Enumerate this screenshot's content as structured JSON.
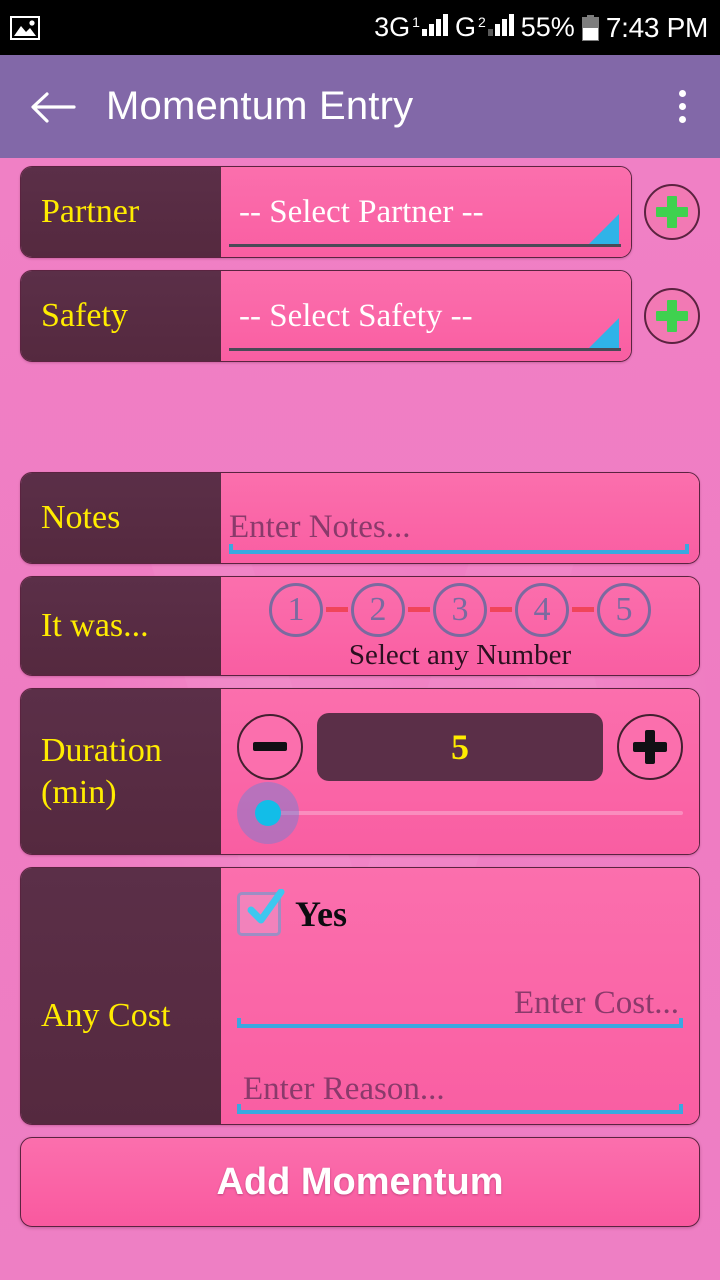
{
  "status_bar": {
    "notification_icon": "gallery-image-icon",
    "sim1_network": "3G",
    "sim1_index": "1",
    "sim2_network": "G",
    "sim2_index": "2",
    "battery_percent": "55%",
    "clock": "7:43 PM"
  },
  "app_bar": {
    "back_icon": "arrow-left-icon",
    "title": "Momentum Entry",
    "overflow_icon": "more-vertical-icon",
    "background_color": "#8268a8"
  },
  "theme": {
    "page_background": "#ef7fc4",
    "label_block": "#5b2f48",
    "label_text": "#ffec00",
    "field_background": "#fb6fad",
    "accent_blue": "#3aa8e0",
    "accent_cyan": "#2fb3e8",
    "accent_green": "#3fd14f",
    "dash_red": "#f0455a",
    "circle_purple": "#7b6aa0"
  },
  "form": {
    "partner": {
      "label": "Partner",
      "selected": "-- Select Partner --",
      "add_button": "add-partner-button"
    },
    "safety": {
      "label": "Safety",
      "selected": "-- Select Safety --",
      "add_button": "add-safety-button"
    },
    "notes": {
      "label": "Notes",
      "placeholder": "Enter Notes...",
      "value": ""
    },
    "rating": {
      "label": "It was...",
      "options": [
        "1",
        "2",
        "3",
        "4",
        "5"
      ],
      "hint": "Select any Number",
      "selected": ""
    },
    "duration": {
      "label_line1": "Duration",
      "label_line2": "(min)",
      "decrement": "−",
      "increment": "+",
      "value": "5",
      "slider_position_percent": 0
    },
    "cost": {
      "label": "Any Cost",
      "checkbox_label": "Yes",
      "checkbox_checked": true,
      "cost_placeholder": "Enter Cost...",
      "cost_value": "",
      "reason_placeholder": "Enter Reason...",
      "reason_value": ""
    }
  },
  "submit": {
    "label": "Add Momentum"
  }
}
